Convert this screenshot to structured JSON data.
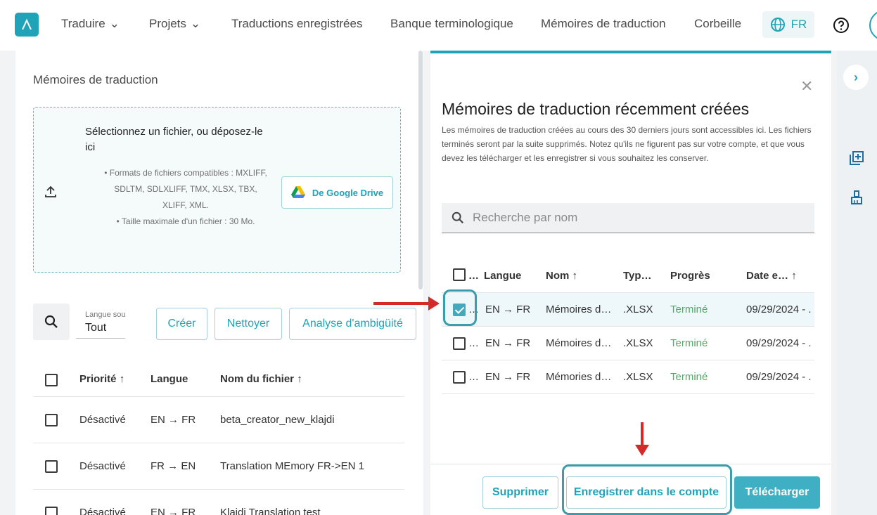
{
  "nav": {
    "items": [
      "Traduire",
      "Projets",
      "Traductions enregistrées",
      "Banque terminologique",
      "Mémoires de traduction",
      "Corbeille"
    ],
    "lang": "FR"
  },
  "left": {
    "title": "Mémoires de traduction",
    "dropzone": {
      "title": "Sélectionnez un fichier, ou déposez-le ici",
      "formats": "Formats de fichiers compatibles : MXLIFF, SDLTM, SDLXLIFF, TMX, XLSX, TBX, XLIFF, XML.",
      "max_size": "Taille maximale d'un fichier : 30 Mo.",
      "gdrive_label": "De Google Drive"
    },
    "toolbar": {
      "lang_label": "Langue source",
      "lang_value": "Tout",
      "create": "Créer",
      "clean": "Nettoyer",
      "ambiguity": "Analyse d'ambigüité"
    },
    "table": {
      "headers": [
        "Priorité",
        "Langue",
        "Nom du fichier"
      ],
      "rows": [
        {
          "priority": "Désactivé",
          "lang": "EN → FR",
          "name": "beta_creator_new_klajdi"
        },
        {
          "priority": "Désactivé",
          "lang": "FR → EN",
          "name": "Translation MEmory FR->EN 1"
        },
        {
          "priority": "Désactivé",
          "lang": "EN → FR",
          "name": "Klajdi Translation test"
        }
      ]
    }
  },
  "right": {
    "title": "Mémoires de traduction récemment créées",
    "description": "Les mémoires de traduction créées au cours des 30 derniers jours sont accessibles ici. Les fichiers terminés seront par la suite supprimés. Notez qu'ils ne figurent pas sur votre compte, et que vous devez les télécharger et les enregistrer si vous souhaitez les conserver.",
    "search_placeholder": "Recherche par nom",
    "table": {
      "headers": {
        "dots": "…",
        "lang": "Langue",
        "name": "Nom",
        "type": "Typ…",
        "progress": "Progrès",
        "date": "Date e…"
      },
      "rows": [
        {
          "dots": "…",
          "lang": "EN → FR",
          "name": "Mémoires d…",
          "type": ".XLSX",
          "progress": "Terminé",
          "date": "09/29/2024 - .",
          "checked": true
        },
        {
          "dots": "…",
          "lang": "EN → FR",
          "name": "Mémoires d…",
          "type": ".XLSX",
          "progress": "Terminé",
          "date": "09/29/2024 - .",
          "checked": false
        },
        {
          "dots": "…",
          "lang": "EN → FR",
          "name": "Mémories d…",
          "type": ".XLSX",
          "progress": "Terminé",
          "date": "09/29/2024 - .",
          "checked": false
        }
      ]
    },
    "footer": {
      "delete": "Supprimer",
      "save": "Enregistrer dans le compte",
      "download": "Télécharger"
    }
  },
  "colors": {
    "accent": "#1fa3b8",
    "done": "#54a86a",
    "arrow": "#d42a2a"
  }
}
